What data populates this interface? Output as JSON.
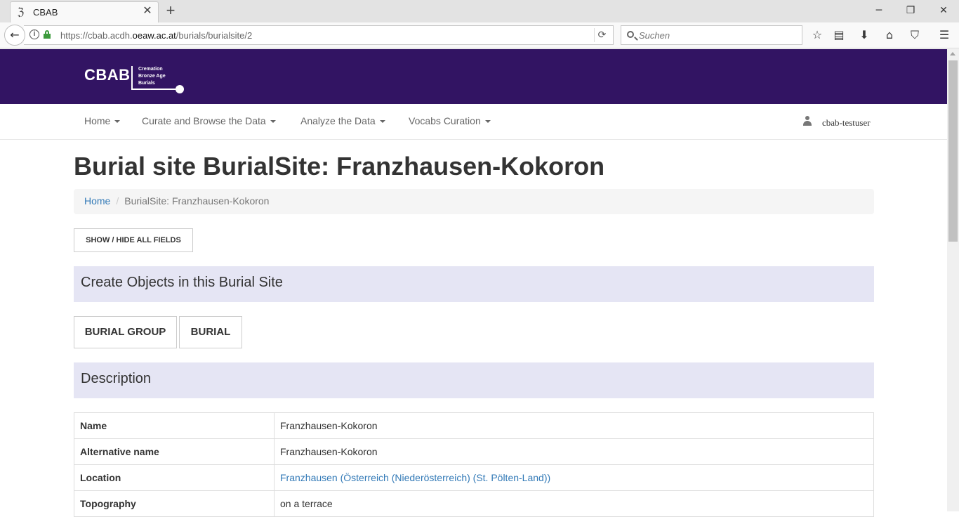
{
  "browser": {
    "tab_title": "CBAB",
    "url_prefix": "https://cbab.acdh.",
    "url_domain": "oeaw.ac.at",
    "url_path": "/burials/burialsite/2",
    "search_placeholder": "Suchen"
  },
  "header": {
    "logo_text": "CBAB",
    "logo_subtitle_1": "Cremation",
    "logo_subtitle_2": "Bronze Age",
    "logo_subtitle_3": "Burials",
    "brand_color": "#321463"
  },
  "nav": {
    "items": [
      {
        "label": "Home"
      },
      {
        "label": "Curate and Browse the Data"
      },
      {
        "label": "Analyze the Data"
      },
      {
        "label": "Vocabs Curation"
      }
    ],
    "user": "cbab-testuser"
  },
  "page": {
    "title": "Burial site BurialSite: Franzhausen-Kokoron",
    "breadcrumb_home": "Home",
    "breadcrumb_current": "BurialSite: Franzhausen-Kokoron",
    "toggle_label": "SHOW / HIDE ALL FIELDS",
    "create_heading": "Create Objects in this Burial Site",
    "create_buttons": [
      {
        "label": "BURIAL GROUP"
      },
      {
        "label": "BURIAL"
      }
    ],
    "description_heading": "Description",
    "fields": [
      {
        "key": "Name",
        "value": "Franzhausen-Kokoron"
      },
      {
        "key": "Alternative name",
        "value": "Franzhausen-Kokoron"
      },
      {
        "key": "Location",
        "value": "Franzhausen (Österreich (Niederösterreich) (St. Pölten-Land))"
      },
      {
        "key": "Topography",
        "value": "on a terrace"
      }
    ],
    "link_color": "#337ab7",
    "section_bg": "#e5e5f4"
  }
}
